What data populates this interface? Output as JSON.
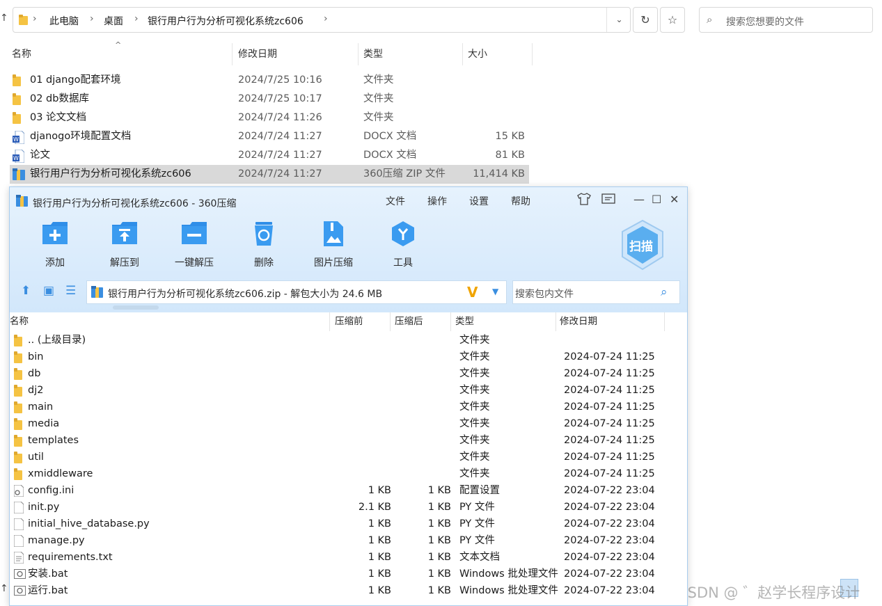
{
  "explorer": {
    "breadcrumb": [
      "此电脑",
      "桌面",
      "银行用户行为分析可视化系统zc606"
    ],
    "search_placeholder": "搜索您想要的文件",
    "columns": {
      "name": "名称",
      "modified": "修改日期",
      "type": "类型",
      "size": "大小"
    },
    "files": [
      {
        "name": "01 django配套环境",
        "date": "2024/7/25 10:16",
        "type": "文件夹",
        "size": "",
        "icon": "folder-icon"
      },
      {
        "name": "02 db数据库",
        "date": "2024/7/25 10:17",
        "type": "文件夹",
        "size": "",
        "icon": "folder-icon"
      },
      {
        "name": "03 论文文档",
        "date": "2024/7/24 11:26",
        "type": "文件夹",
        "size": "",
        "icon": "folder-icon"
      },
      {
        "name": "djanogo环境配置文档",
        "date": "2024/7/24 11:27",
        "type": "DOCX 文档",
        "size": "15 KB",
        "icon": "word-doc-icon"
      },
      {
        "name": "论文",
        "date": "2024/7/24 11:27",
        "type": "DOCX 文档",
        "size": "81 KB",
        "icon": "word-doc-icon"
      },
      {
        "name": "银行用户行为分析可视化系统zc606",
        "date": "2024/7/24 11:27",
        "type": "360压缩 ZIP 文件",
        "size": "11,414 KB",
        "icon": "zip-archive-icon",
        "selected": true
      }
    ]
  },
  "zip_window": {
    "title": "银行用户行为分析可视化系统zc606 - 360压缩",
    "menu": [
      "文件",
      "操作",
      "设置",
      "帮助"
    ],
    "toolbar": [
      {
        "label": "添加",
        "icon": "add-folder-icon"
      },
      {
        "label": "解压到",
        "icon": "extract-to-icon"
      },
      {
        "label": "一键解压",
        "icon": "one-click-extract-icon"
      },
      {
        "label": "删除",
        "icon": "recycle-delete-icon"
      },
      {
        "label": "图片压缩",
        "icon": "image-compress-icon"
      },
      {
        "label": "工具",
        "icon": "tools-icon"
      }
    ],
    "scan_label": "扫描",
    "path_text": "银行用户行为分析可视化系统zc606.zip - 解包大小为 24.6 MB",
    "search_placeholder": "搜索包内文件",
    "columns": {
      "name": "名称",
      "compressed": "压缩前",
      "packed": "压缩后",
      "type": "类型",
      "modified": "修改日期"
    },
    "entries": [
      {
        "name": ".. (上级目录)",
        "before": "",
        "after": "",
        "type": "文件夹",
        "date": "",
        "icon": "folder-icon"
      },
      {
        "name": "bin",
        "before": "",
        "after": "",
        "type": "文件夹",
        "date": "2024-07-24 11:25",
        "icon": "folder-icon"
      },
      {
        "name": "db",
        "before": "",
        "after": "",
        "type": "文件夹",
        "date": "2024-07-24 11:25",
        "icon": "folder-icon"
      },
      {
        "name": "dj2",
        "before": "",
        "after": "",
        "type": "文件夹",
        "date": "2024-07-24 11:25",
        "icon": "folder-icon"
      },
      {
        "name": "main",
        "before": "",
        "after": "",
        "type": "文件夹",
        "date": "2024-07-24 11:25",
        "icon": "folder-icon"
      },
      {
        "name": "media",
        "before": "",
        "after": "",
        "type": "文件夹",
        "date": "2024-07-24 11:25",
        "icon": "folder-icon"
      },
      {
        "name": "templates",
        "before": "",
        "after": "",
        "type": "文件夹",
        "date": "2024-07-24 11:25",
        "icon": "folder-icon"
      },
      {
        "name": "util",
        "before": "",
        "after": "",
        "type": "文件夹",
        "date": "2024-07-24 11:25",
        "icon": "folder-icon"
      },
      {
        "name": "xmiddleware",
        "before": "",
        "after": "",
        "type": "文件夹",
        "date": "2024-07-24 11:25",
        "icon": "folder-icon"
      },
      {
        "name": "config.ini",
        "before": "1 KB",
        "after": "1 KB",
        "type": "配置设置",
        "date": "2024-07-22 23:04",
        "icon": "config-file-icon"
      },
      {
        "name": "init.py",
        "before": "2.1 KB",
        "after": "1 KB",
        "type": "PY 文件",
        "date": "2024-07-22 23:04",
        "icon": "blank-file-icon"
      },
      {
        "name": "initial_hive_database.py",
        "before": "1 KB",
        "after": "1 KB",
        "type": "PY 文件",
        "date": "2024-07-22 23:04",
        "icon": "blank-file-icon"
      },
      {
        "name": "manage.py",
        "before": "1 KB",
        "after": "1 KB",
        "type": "PY 文件",
        "date": "2024-07-22 23:04",
        "icon": "blank-file-icon"
      },
      {
        "name": "requirements.txt",
        "before": "1 KB",
        "after": "1 KB",
        "type": "文本文档",
        "date": "2024-07-22 23:04",
        "icon": "text-file-icon"
      },
      {
        "name": "安装.bat",
        "before": "1 KB",
        "after": "1 KB",
        "type": "Windows 批处理文件",
        "date": "2024-07-22 23:04",
        "icon": "batch-file-icon"
      },
      {
        "name": "运行.bat",
        "before": "1 KB",
        "after": "1 KB",
        "type": "Windows 批处理文件",
        "date": "2024-07-22 23:04",
        "icon": "batch-file-icon"
      }
    ]
  },
  "watermark": "CSDN @ ゛赵学长程序设计",
  "colors": {
    "accent": "#3a8ee0",
    "folder": "#f5c343",
    "selection": "#d9d9d9",
    "zip_header": "#d2e7fb"
  }
}
